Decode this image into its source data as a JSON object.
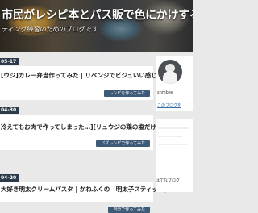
{
  "site": {
    "title": "市民がレシピ本とパス販で色にかけするブログ",
    "description": "ティング練習のためのブログです"
  },
  "posts": [
    {
      "date": "05-17",
      "title": "[ウジ]カレー弁当作ってみた | リベンジでビジュいい感じ",
      "category": "レシピを作ってみた"
    },
    {
      "date": "04-30",
      "title": "冷えてもお肉で作ってしまった…][リュウジの鶏の塩だけ煮込み風",
      "category": "パズレシピで作ってみた"
    },
    {
      "date": "04-20",
      "title": "大好き明太クリームパスタ | かねふくの「明太子スティック」で簡",
      "category": "自分で作ってみた"
    }
  ],
  "sidebar": {
    "author_name": "shmbee",
    "about_link": "このブログを",
    "footer_text": "はてなブログ"
  }
}
